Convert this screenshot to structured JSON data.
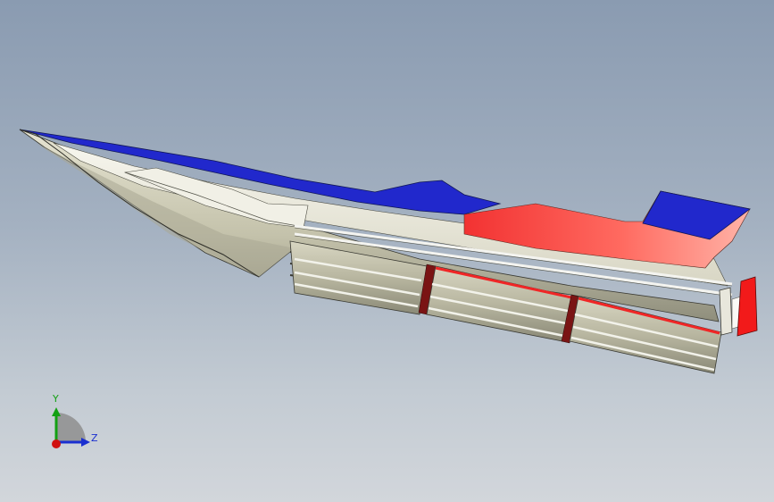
{
  "viewport": {
    "background_top": "#8a9bb1",
    "background_bottom": "#d2d6db"
  },
  "model": {
    "name": "boat-hull",
    "colors": {
      "hull_side": "#cfcdb6",
      "hull_shadow": "#9b9a86",
      "deck_blue": "#2128cc",
      "stripe_red": "#f03030",
      "stripe_pink": "#ff9c90",
      "pontoon_body": "#c4c2ac",
      "pontoon_dark": "#76756a",
      "rail_white": "#f4f4f0"
    }
  },
  "triad": {
    "y_label": "Y",
    "z_label": "Z",
    "y_color": "#13a013",
    "z_color": "#1a2fd0",
    "x_color": "#d01010"
  }
}
